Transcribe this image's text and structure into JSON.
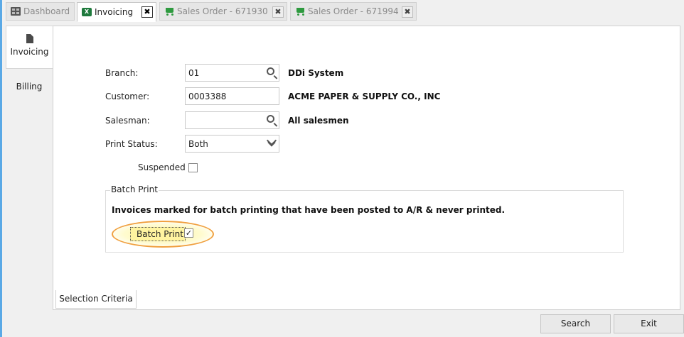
{
  "tabs": [
    {
      "label": "Dashboard",
      "icon": "dashboard-icon",
      "active": false
    },
    {
      "label": "Invoicing",
      "icon": "excel-icon",
      "icon_text": "X",
      "active": true
    },
    {
      "label": "Sales Order - 671930",
      "icon": "cart-icon",
      "active": false
    },
    {
      "label": "Sales Order - 671994",
      "icon": "cart-icon",
      "active": false
    }
  ],
  "sidebar": {
    "items": [
      {
        "label": "Invoicing",
        "icon": "document-icon",
        "active": true
      },
      {
        "label": "Billing",
        "active": false
      }
    ]
  },
  "form": {
    "branch": {
      "label": "Branch:",
      "value": "01",
      "desc": "DDi System"
    },
    "customer": {
      "label": "Customer:",
      "value": "0003388",
      "desc": "ACME PAPER & SUPPLY CO., INC"
    },
    "salesman": {
      "label": "Salesman:",
      "value": "",
      "desc": "All salesmen"
    },
    "print_status": {
      "label": "Print Status:",
      "value": "Both"
    },
    "suspended": {
      "label": "Suspended",
      "checked": false
    }
  },
  "batch_print": {
    "group_title": "Batch Print",
    "info": "Invoices marked for batch printing that have been posted to A/R & never printed.",
    "checkbox_label": "Batch Print",
    "checked": true,
    "check_mark": "✓"
  },
  "bottom_tab": "Selection Criteria",
  "buttons": {
    "search": "Search",
    "exit": "Exit"
  },
  "close_glyph": "✖",
  "colors": {
    "accent": "#5aa9e6",
    "highlight": "#fff4a0",
    "ellipse": "#f0a040",
    "excel_green": "#1f7a3d",
    "cart_green": "#2e9a3f"
  }
}
